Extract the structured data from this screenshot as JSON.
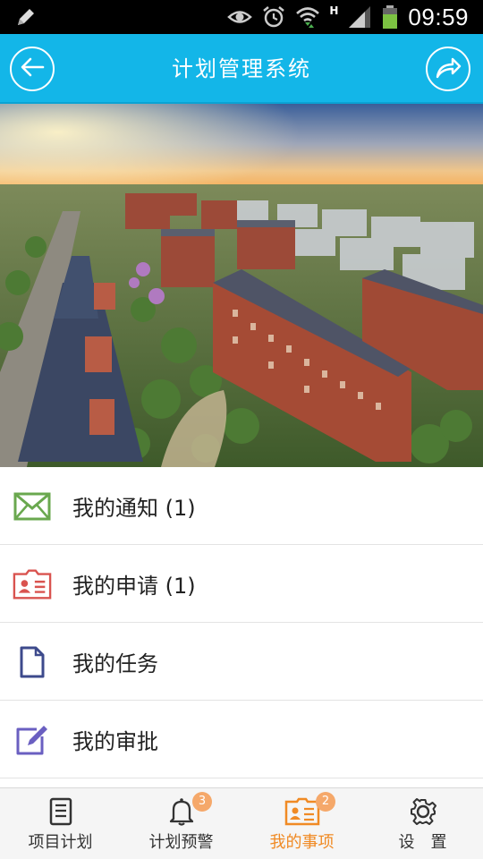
{
  "status_bar": {
    "time": "09:59",
    "network_label": "H",
    "icons": [
      "pencil-icon",
      "eye-icon",
      "alarm-icon",
      "wifi-icon",
      "signal-icon",
      "battery-icon"
    ]
  },
  "header": {
    "title": "计划管理系统",
    "back_icon": "arrow-left-icon",
    "forward_icon": "share-arrow-icon",
    "background_color": "#13b6e8"
  },
  "banner": {
    "image": "aerial rendering of residential apartment complex at sunset"
  },
  "menu": {
    "items": [
      {
        "label": "我的通知 (1)",
        "icon": "envelope-icon",
        "color": "#6aa84f"
      },
      {
        "label": "我的申请 (1)",
        "icon": "id-card-icon",
        "color": "#d9534f"
      },
      {
        "label": "我的任务",
        "icon": "document-icon",
        "color": "#3d4a8c"
      },
      {
        "label": "我的审批",
        "icon": "edit-icon",
        "color": "#6a5fc1"
      }
    ]
  },
  "tabs": {
    "active_color": "#f08a24",
    "items": [
      {
        "label": "项目计划",
        "icon": "clipboard-icon",
        "badge": null
      },
      {
        "label": "计划预警",
        "icon": "bell-icon",
        "badge": "3"
      },
      {
        "label": "我的事项",
        "icon": "id-card-icon",
        "badge": "2",
        "active": true
      },
      {
        "label": "设　置",
        "icon": "gear-icon",
        "badge": null
      }
    ]
  }
}
